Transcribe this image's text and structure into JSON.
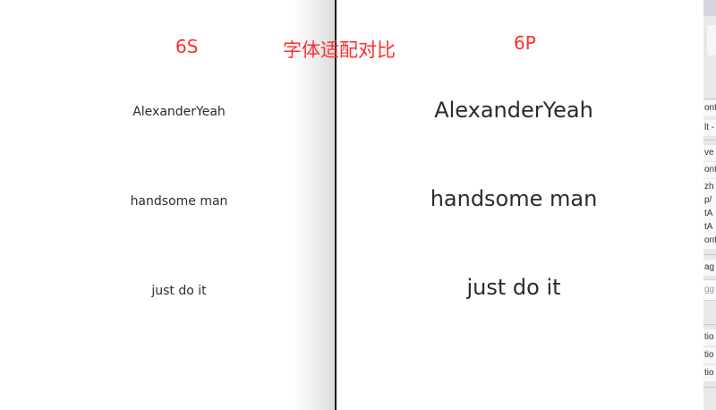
{
  "labels": {
    "left_device": "6S",
    "comparison_title": "字体适配对比",
    "right_device": "6P"
  },
  "left_device": {
    "lines": [
      "AlexanderYeah",
      "handsome man",
      "just do it"
    ]
  },
  "right_device": {
    "lines": [
      "AlexanderYeah",
      "handsome man",
      "just do it"
    ]
  },
  "ide_panel": {
    "snippets": [
      "ont",
      "lt -",
      "ve",
      "ont",
      "zh",
      "p/",
      "tA",
      "tA",
      "ont",
      "ag",
      "gg",
      "tio",
      "tio",
      "tio"
    ]
  },
  "colors": {
    "label_red": "#ff2d2d",
    "text_dark": "#2b2b2b",
    "divider": "#1a1a1a"
  }
}
